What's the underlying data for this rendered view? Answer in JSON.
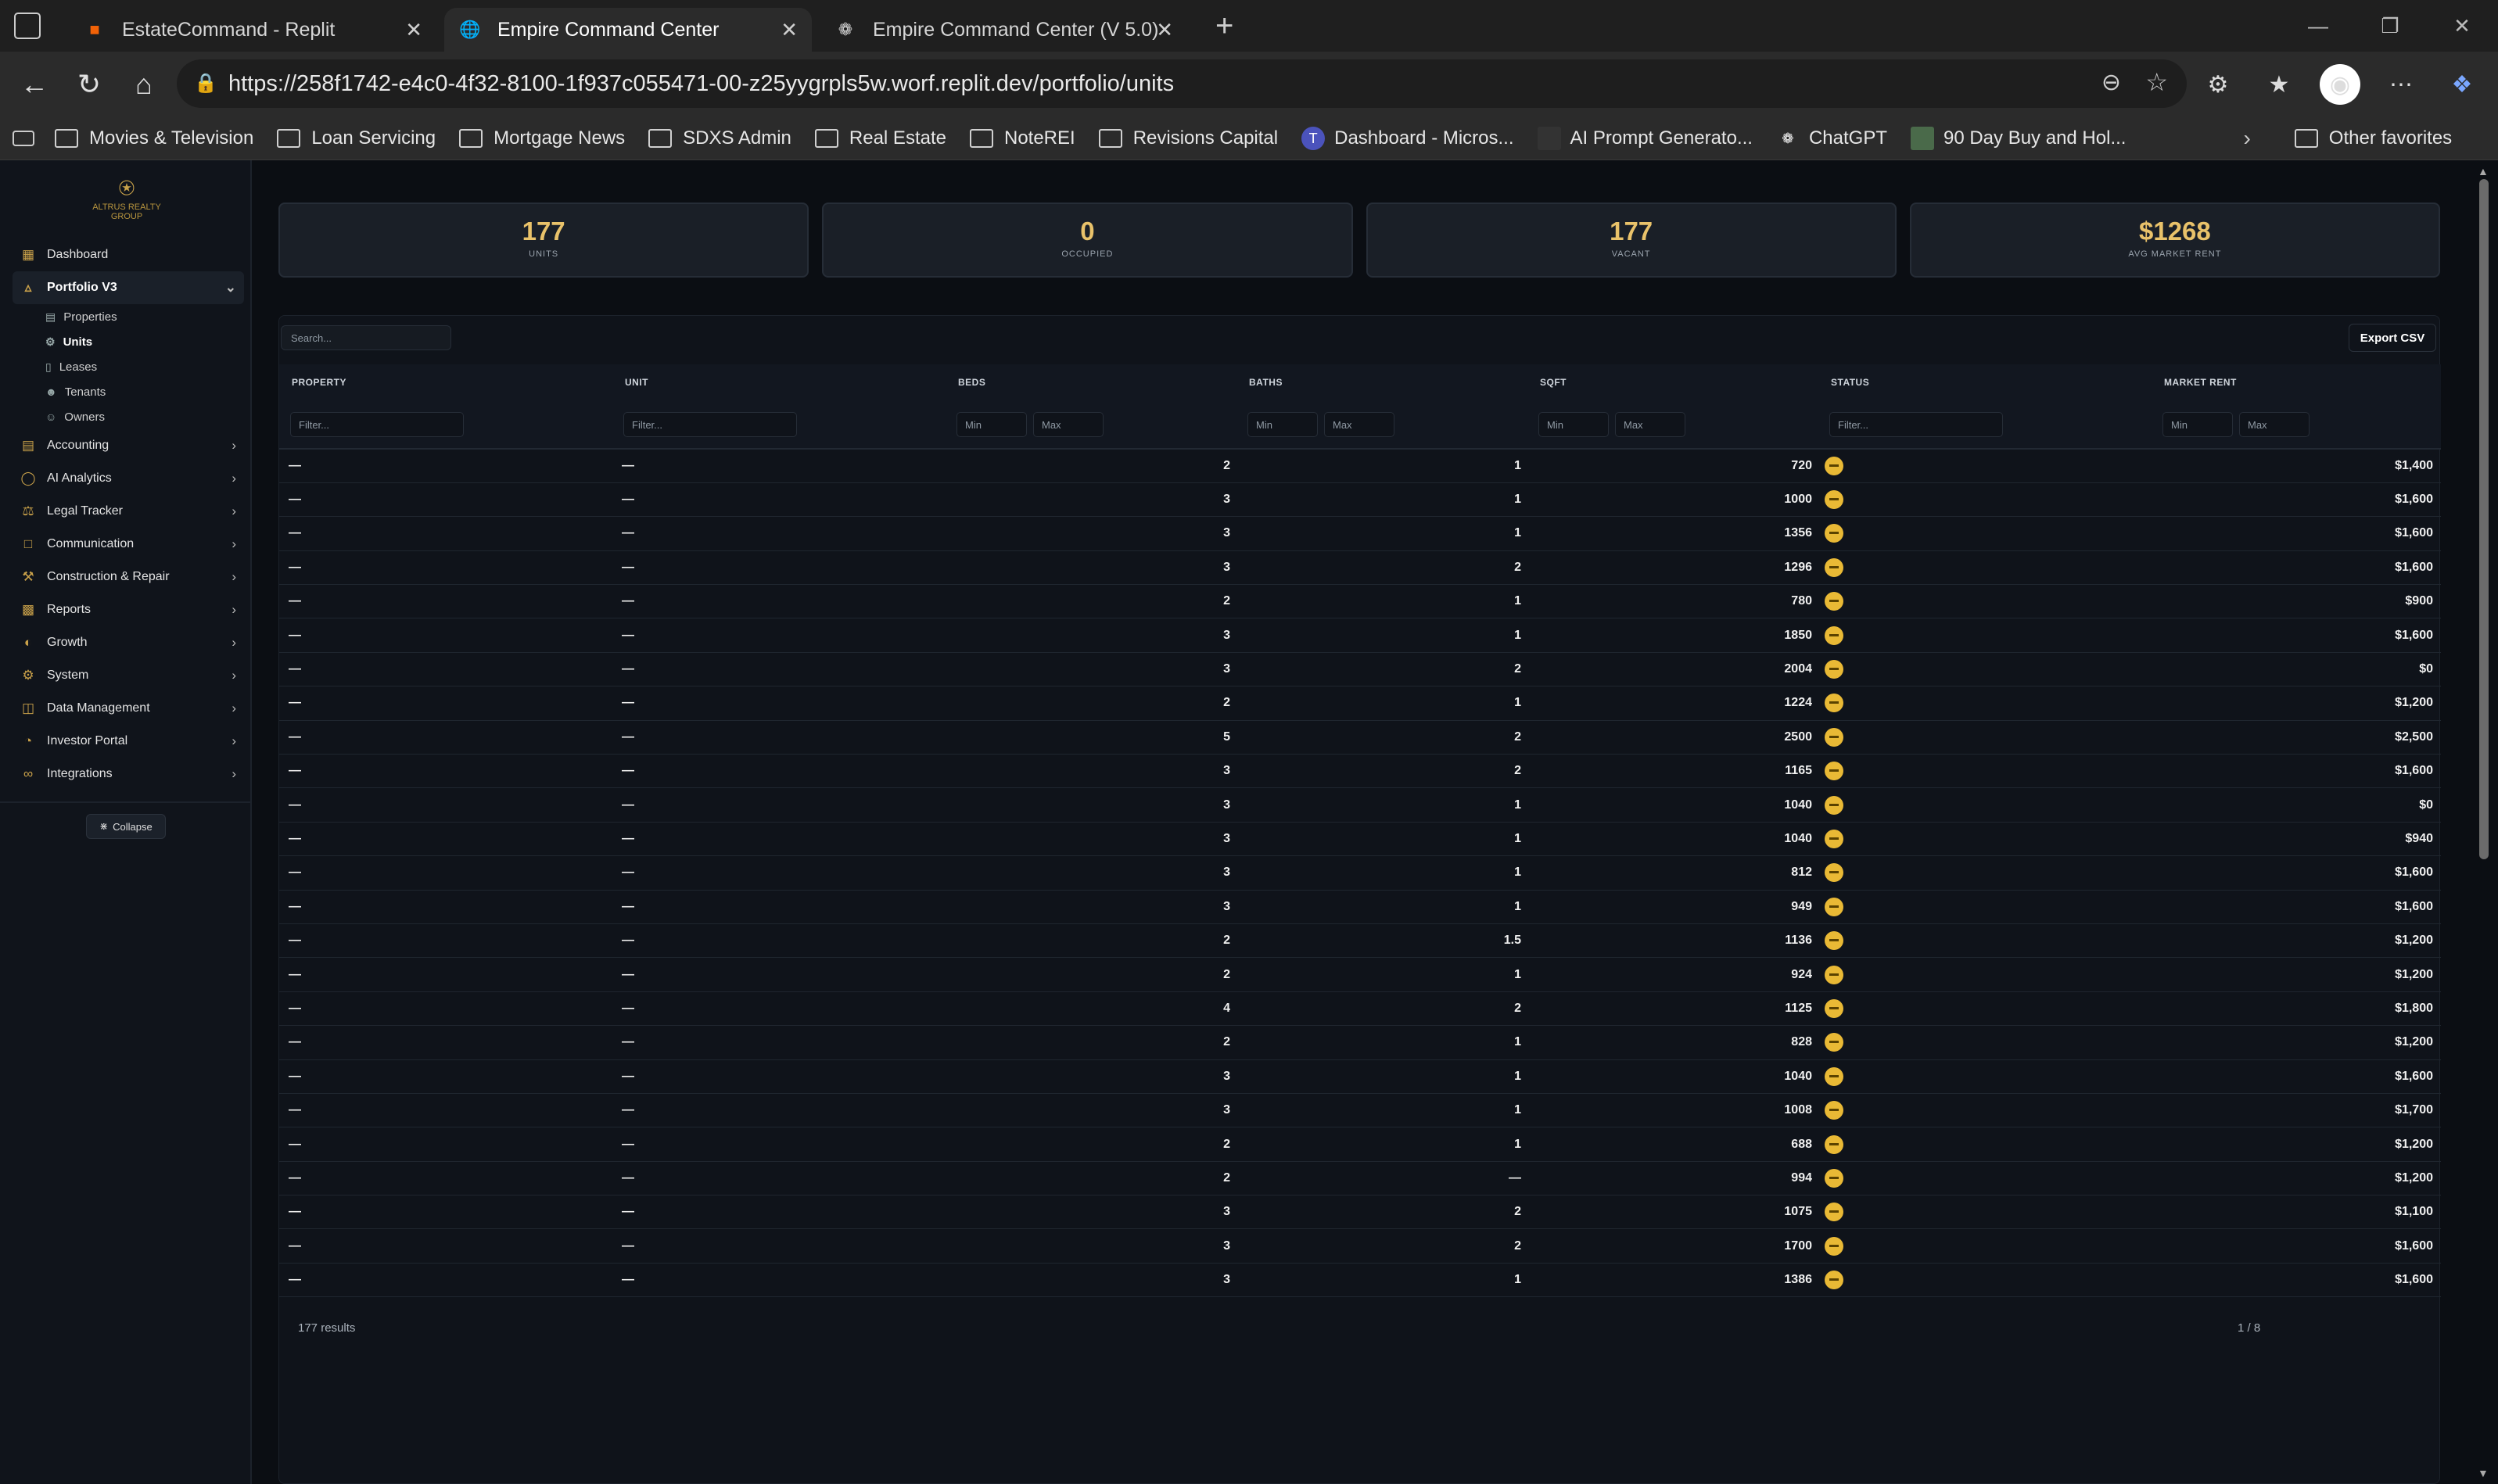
{
  "browser": {
    "tabs": [
      {
        "title": "EstateCommand - Replit",
        "icon": "replit-icon",
        "active": false
      },
      {
        "title": "Empire Command Center",
        "icon": "globe-icon",
        "active": true
      },
      {
        "title": "Empire Command Center (V 5.0)",
        "icon": "openai-icon",
        "active": false
      }
    ],
    "url": "https://258f1742-e4c0-4f32-8100-1f937c055471-00-z25yygrpls5w.worf.replit.dev/portfolio/units",
    "bookmarks": [
      "Movies & Television",
      "Loan Servicing",
      "Mortgage News",
      "SDXS Admin",
      "Real Estate",
      "NoteREI",
      "Revisions Capital",
      "Dashboard - Micros...",
      "AI Prompt Generato...",
      "ChatGPT",
      "90 Day Buy and Hol..."
    ],
    "other_favorites": "Other favorites"
  },
  "sidebar": {
    "logo_text": "ALTRUS REALTY GROUP",
    "items": [
      {
        "label": "Dashboard",
        "icon": "grid-icon"
      },
      {
        "label": "Portfolio V3",
        "icon": "building-icon",
        "expanded": true
      },
      {
        "label": "Accounting",
        "icon": "calculator-icon"
      },
      {
        "label": "AI Analytics",
        "icon": "shield-icon"
      },
      {
        "label": "Legal Tracker",
        "icon": "scale-icon"
      },
      {
        "label": "Communication",
        "icon": "message-icon"
      },
      {
        "label": "Construction & Repair",
        "icon": "wrench-icon"
      },
      {
        "label": "Reports",
        "icon": "chart-icon"
      },
      {
        "label": "Growth",
        "icon": "growth-icon"
      },
      {
        "label": "System",
        "icon": "gear-icon"
      },
      {
        "label": "Data Management",
        "icon": "database-icon"
      },
      {
        "label": "Investor Portal",
        "icon": "portal-icon"
      },
      {
        "label": "Integrations",
        "icon": "link-icon"
      }
    ],
    "subitems": [
      "Properties",
      "Units",
      "Leases",
      "Tenants",
      "Owners"
    ],
    "active_sub": "Units",
    "collapse_label": "Collapse"
  },
  "stats": [
    {
      "value": "177",
      "label": "UNITS"
    },
    {
      "value": "0",
      "label": "OCCUPIED"
    },
    {
      "value": "177",
      "label": "VACANT"
    },
    {
      "value": "$1268",
      "label": "AVG MARKET RENT"
    }
  ],
  "toolbar": {
    "search_placeholder": "Search...",
    "export_label": "Export CSV"
  },
  "table": {
    "headers": [
      "PROPERTY",
      "UNIT",
      "BEDS",
      "BATHS",
      "SQFT",
      "STATUS",
      "MARKET RENT"
    ],
    "filter_placeholder": "Filter...",
    "min_placeholder": "Min",
    "max_placeholder": "Max",
    "rows": [
      [
        "—",
        "—",
        "2",
        "1",
        "720",
        "$1,400"
      ],
      [
        "—",
        "—",
        "3",
        "1",
        "1000",
        "$1,600"
      ],
      [
        "—",
        "—",
        "3",
        "1",
        "1356",
        "$1,600"
      ],
      [
        "—",
        "—",
        "3",
        "2",
        "1296",
        "$1,600"
      ],
      [
        "—",
        "—",
        "2",
        "1",
        "780",
        "$900"
      ],
      [
        "—",
        "—",
        "3",
        "1",
        "1850",
        "$1,600"
      ],
      [
        "—",
        "—",
        "3",
        "2",
        "2004",
        "$0"
      ],
      [
        "—",
        "—",
        "2",
        "1",
        "1224",
        "$1,200"
      ],
      [
        "—",
        "—",
        "5",
        "2",
        "2500",
        "$2,500"
      ],
      [
        "—",
        "—",
        "3",
        "2",
        "1165",
        "$1,600"
      ],
      [
        "—",
        "—",
        "3",
        "1",
        "1040",
        "$0"
      ],
      [
        "—",
        "—",
        "3",
        "1",
        "1040",
        "$940"
      ],
      [
        "—",
        "—",
        "3",
        "1",
        "812",
        "$1,600"
      ],
      [
        "—",
        "—",
        "3",
        "1",
        "949",
        "$1,600"
      ],
      [
        "—",
        "—",
        "2",
        "1.5",
        "1136",
        "$1,200"
      ],
      [
        "—",
        "—",
        "2",
        "1",
        "924",
        "$1,200"
      ],
      [
        "—",
        "—",
        "4",
        "2",
        "1125",
        "$1,800"
      ],
      [
        "—",
        "—",
        "2",
        "1",
        "828",
        "$1,200"
      ],
      [
        "—",
        "—",
        "3",
        "1",
        "1040",
        "$1,600"
      ],
      [
        "—",
        "—",
        "3",
        "1",
        "1008",
        "$1,700"
      ],
      [
        "—",
        "—",
        "2",
        "1",
        "688",
        "$1,200"
      ],
      [
        "—",
        "—",
        "2",
        "—",
        "994",
        "$1,200"
      ],
      [
        "—",
        "—",
        "3",
        "2",
        "1075",
        "$1,100"
      ],
      [
        "—",
        "—",
        "3",
        "2",
        "1700",
        "$1,600"
      ],
      [
        "—",
        "—",
        "3",
        "1",
        "1386",
        "$1,600"
      ]
    ],
    "status_color": "#e9b935"
  },
  "footer": {
    "results": "177 results",
    "page": "1 / 8"
  }
}
